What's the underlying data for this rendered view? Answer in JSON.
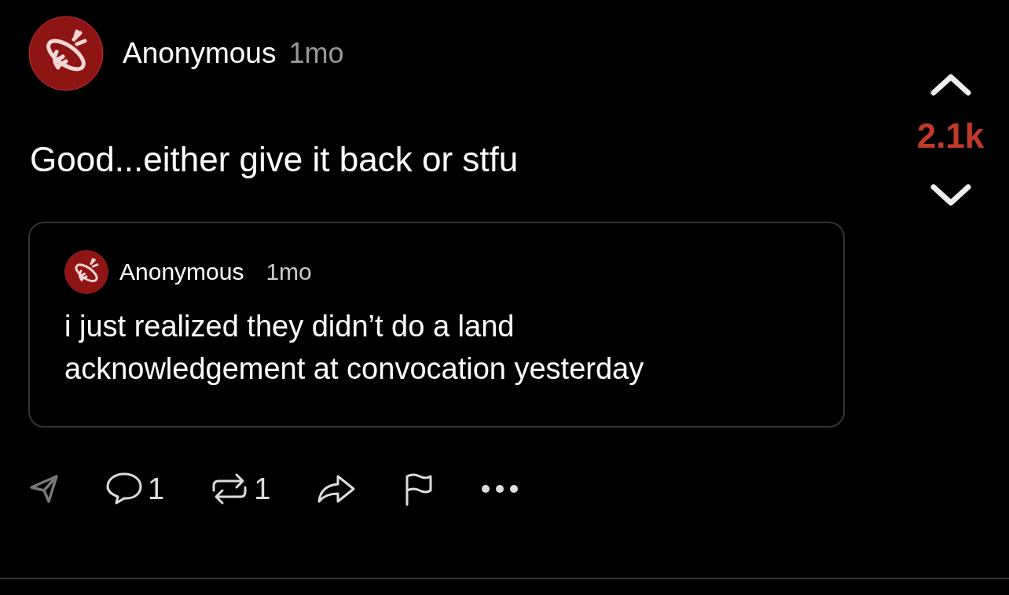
{
  "post": {
    "author": "Anonymous",
    "time": "1mo",
    "text": "Good...either give it back or stfu",
    "quote": {
      "author": "Anonymous",
      "time": "1mo",
      "text": "i just realized they didn’t do a land acknowledgement at convocation yesterday"
    },
    "actions": [
      {
        "kind": "send"
      },
      {
        "kind": "comment",
        "count": "1"
      },
      {
        "kind": "repost",
        "count": "1"
      },
      {
        "kind": "share"
      },
      {
        "kind": "flag"
      },
      {
        "kind": "more"
      }
    ],
    "vote": {
      "count": "2.1k",
      "upvoted": true
    }
  }
}
